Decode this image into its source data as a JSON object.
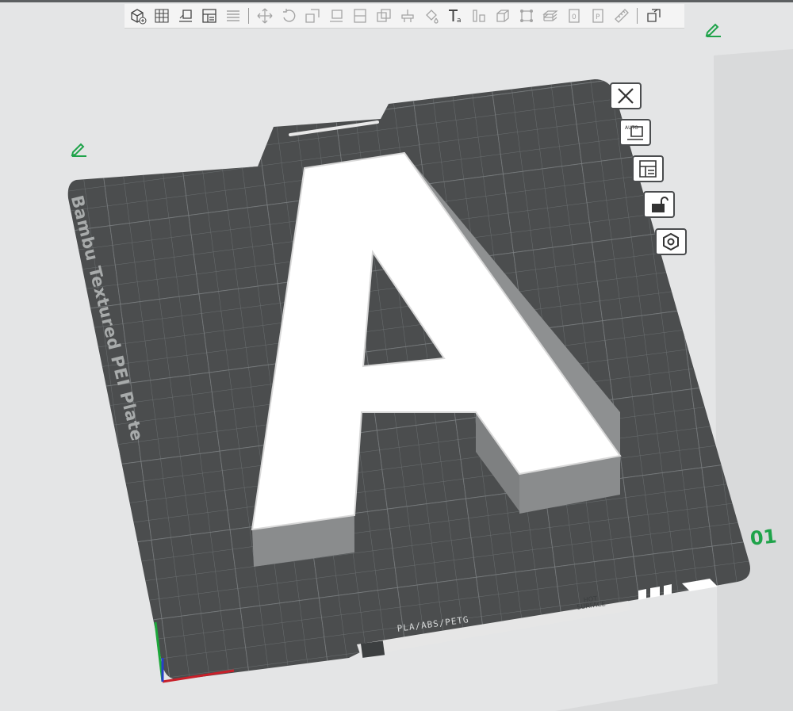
{
  "toolbar": {
    "items": [
      {
        "icon": "add-cube-icon",
        "state": "normal"
      },
      {
        "icon": "grid-icon",
        "state": "normal"
      },
      {
        "icon": "auto-orient-icon",
        "state": "normal"
      },
      {
        "icon": "arrange-icon",
        "state": "normal"
      },
      {
        "icon": "layers-icon",
        "state": "dim"
      },
      {
        "icon": "move-icon",
        "state": "dim"
      },
      {
        "icon": "rotate-icon",
        "state": "dim"
      },
      {
        "icon": "scale-icon",
        "state": "dim"
      },
      {
        "icon": "lay-on-face-icon",
        "state": "dim"
      },
      {
        "icon": "cut-icon",
        "state": "dim"
      },
      {
        "icon": "mesh-boolean-icon",
        "state": "dim"
      },
      {
        "icon": "support-paint-icon",
        "state": "dim"
      },
      {
        "icon": "color-paint-icon",
        "state": "dim"
      },
      {
        "icon": "text-icon",
        "state": "normal"
      },
      {
        "icon": "measure-icon",
        "state": "dim"
      },
      {
        "icon": "assembly-icon",
        "state": "dim"
      },
      {
        "icon": "brim-ears-icon",
        "state": "dim"
      },
      {
        "icon": "variable-layer-icon",
        "state": "dim"
      },
      {
        "icon": "seam-icon",
        "state": "dim"
      },
      {
        "icon": "plate-0-icon",
        "state": "dim"
      },
      {
        "icon": "plate-p-icon",
        "state": "dim"
      },
      {
        "icon": "ruler-icon",
        "state": "dim"
      },
      {
        "icon": "explode-icon",
        "state": "normal"
      }
    ]
  },
  "plate": {
    "label": "Bambu Textured PEI Plate",
    "number": "01",
    "material_label": "PLA/ABS/PETG",
    "warning_line1": "HOT",
    "warning_line2": "SURFACE"
  },
  "plate_buttons": [
    {
      "icon": "close-icon"
    },
    {
      "icon": "auto-orient-icon"
    },
    {
      "icon": "arrange-icon"
    },
    {
      "icon": "lock-open-icon"
    },
    {
      "icon": "plate-settings-icon"
    }
  ],
  "model": {
    "letter": "A"
  },
  "colors": {
    "background": "#e4e5e6",
    "plate": "#4b4d4e",
    "grid": "#6a6e70",
    "model_top": "#ffffff",
    "model_side": "#8a8c8d",
    "accent": "#1fa34a"
  }
}
